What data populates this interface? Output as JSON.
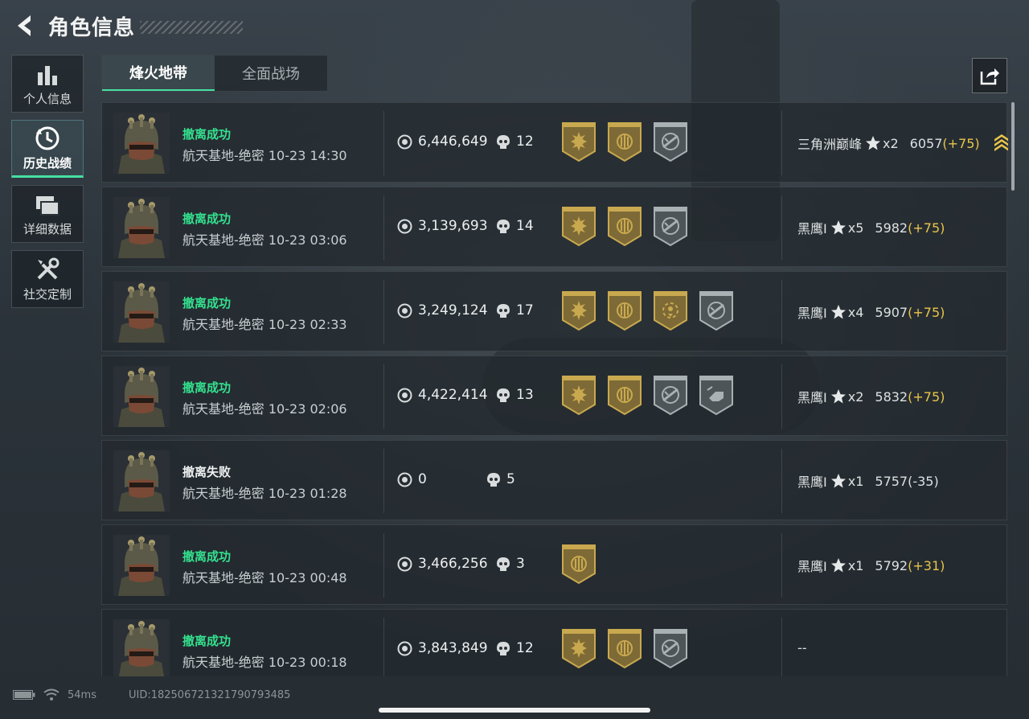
{
  "header": {
    "title": "角色信息"
  },
  "sidenav": [
    {
      "label": "个人信息",
      "icon": "bar-chart-icon",
      "active": false
    },
    {
      "label": "历史战绩",
      "icon": "history-clock-icon",
      "active": true
    },
    {
      "label": "详细数据",
      "icon": "folder-stack-icon",
      "active": false
    },
    {
      "label": "社交定制",
      "icon": "tools-icon",
      "active": false
    }
  ],
  "tabs": [
    {
      "label": "烽火地带",
      "active": true
    },
    {
      "label": "全面战场",
      "active": false
    }
  ],
  "colors": {
    "success": "#34e08e",
    "delta_positive": "#e9c54a",
    "badge_gold": "#c9a94f",
    "badge_silver": "#aab1b4",
    "accent": "#46e0a2"
  },
  "matches": [
    {
      "result": "撤离成功",
      "success": true,
      "map": "航天基地-绝密",
      "time": "10-23 14:30",
      "money": "6,446,649",
      "kills": "12",
      "badges": [
        "gold-sun-badge-icon",
        "gold-emblem-badge-icon",
        "silver-rifle-badge-icon"
      ],
      "rank": "三角洲巅峰",
      "stars": "x2",
      "score": "6057",
      "delta": "(+75)",
      "delta_positive": true,
      "chevron": true
    },
    {
      "result": "撤离成功",
      "success": true,
      "map": "航天基地-绝密",
      "time": "10-23 03:06",
      "money": "3,139,693",
      "kills": "14",
      "badges": [
        "gold-sun-badge-icon",
        "gold-emblem-badge-icon",
        "silver-rifle-badge-icon"
      ],
      "rank": "黑鹰I",
      "stars": "x5",
      "score": "5982",
      "delta": "(+75)",
      "delta_positive": true
    },
    {
      "result": "撤离成功",
      "success": true,
      "map": "航天基地-绝密",
      "time": "10-23 02:33",
      "money": "3,249,124",
      "kills": "17",
      "badges": [
        "gold-sun-badge-icon",
        "gold-emblem-badge-icon",
        "gold-target-badge-icon",
        "silver-rifle-badge-icon"
      ],
      "rank": "黑鹰I",
      "stars": "x4",
      "score": "5907",
      "delta": "(+75)",
      "delta_positive": true
    },
    {
      "result": "撤离成功",
      "success": true,
      "map": "航天基地-绝密",
      "time": "10-23 02:06",
      "money": "4,422,414",
      "kills": "13",
      "badges": [
        "gold-sun-badge-icon",
        "gold-emblem-badge-icon",
        "silver-rifle-badge-icon",
        "silver-fist-badge-icon"
      ],
      "rank": "黑鹰I",
      "stars": "x2",
      "score": "5832",
      "delta": "(+75)",
      "delta_positive": true
    },
    {
      "result": "撤离失败",
      "success": false,
      "map": "航天基地-绝密",
      "time": "10-23 01:28",
      "money": "0",
      "kills": "5",
      "badges": [],
      "rank": "黑鹰I",
      "stars": "x1",
      "score": "5757",
      "delta": "(-35)",
      "delta_positive": false
    },
    {
      "result": "撤离成功",
      "success": true,
      "map": "航天基地-绝密",
      "time": "10-23 00:48",
      "money": "3,466,256",
      "kills": "3",
      "badges": [
        "gold-emblem-badge-icon"
      ],
      "rank": "黑鹰I",
      "stars": "x1",
      "score": "5792",
      "delta": "(+31)",
      "delta_positive": true
    },
    {
      "result": "撤离成功",
      "success": true,
      "map": "航天基地-绝密",
      "time": "10-23 00:18",
      "money": "3,843,849",
      "kills": "12",
      "badges": [
        "gold-sun-badge-icon",
        "gold-emblem-badge-icon",
        "silver-rifle-badge-icon"
      ],
      "rank_text": "--"
    }
  ],
  "footer": {
    "ping": "54ms",
    "uid": "UID:182506721321790793485"
  }
}
